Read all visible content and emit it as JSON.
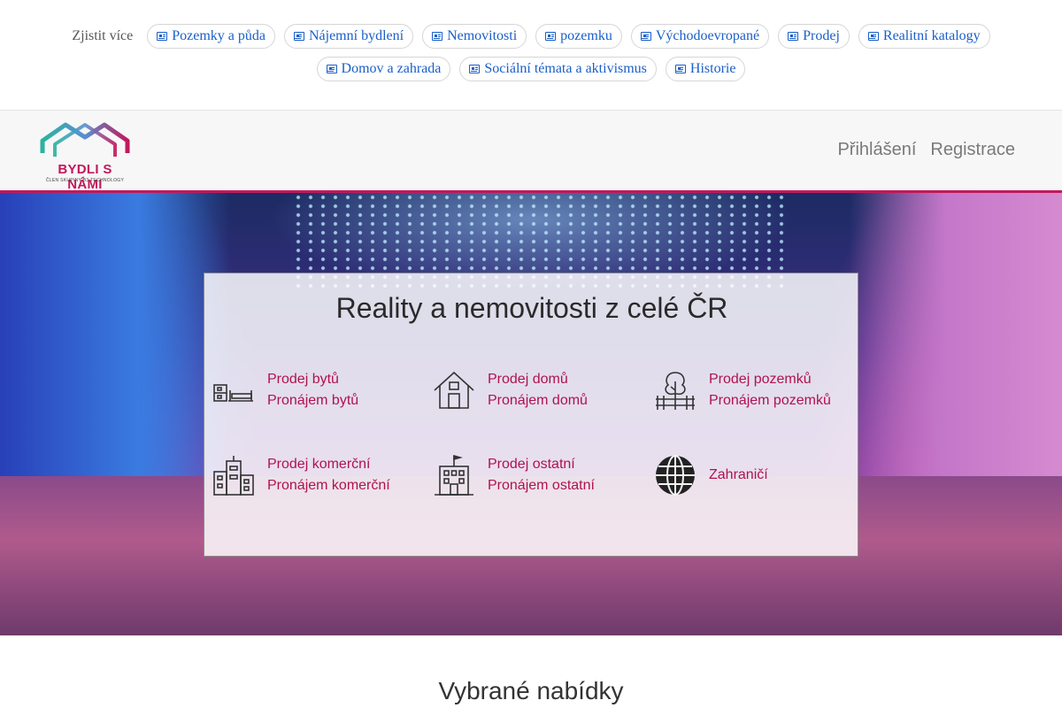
{
  "tags": {
    "label": "Zjistit více",
    "row1": [
      "Pozemky a půda",
      "Nájemní bydlení",
      "Nemovitosti",
      "pozemku",
      "Východoevropané",
      "Prodej",
      "Realitní katalogy"
    ],
    "row2": [
      "Domov a zahrada",
      "Sociální témata a aktivismus",
      "Historie"
    ]
  },
  "header": {
    "logo_text": "BYDLI S NÁMI",
    "logo_sub": "ČLEN SKUPINY B3 TECHNOLOGY",
    "login": "Přihlášení",
    "register": "Registrace",
    "accent": "#c2185b"
  },
  "hero": {
    "title": "Reality a nemovitosti z celé ČR",
    "categories": [
      {
        "icon": "apartment-icon",
        "links": [
          "Prodej bytů",
          "Pronájem bytů"
        ]
      },
      {
        "icon": "house-icon",
        "links": [
          "Prodej domů",
          "Pronájem domů"
        ]
      },
      {
        "icon": "land-tree-icon",
        "links": [
          "Prodej pozemků",
          "Pronájem pozemků"
        ]
      },
      {
        "icon": "commercial-buildings-icon",
        "links": [
          "Prodej komerční",
          "Pronájem komerční"
        ]
      },
      {
        "icon": "other-building-icon",
        "links": [
          "Prodej ostatní",
          "Pronájem ostatní"
        ]
      },
      {
        "icon": "globe-icon",
        "links": [
          "Zahraničí"
        ]
      }
    ]
  },
  "offers": {
    "title": "Vybrané nabídky"
  }
}
